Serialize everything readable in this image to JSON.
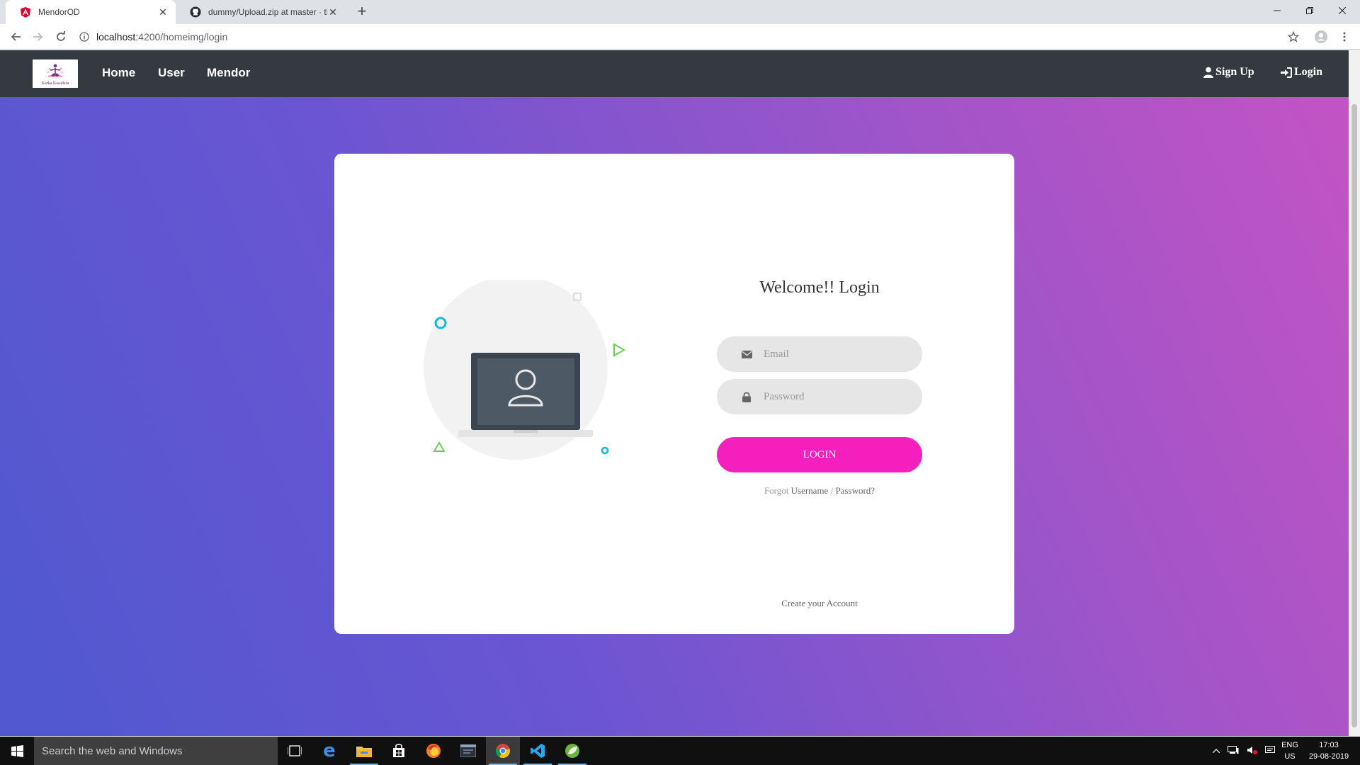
{
  "browser": {
    "tabs": [
      {
        "title": "MendorOD",
        "active": true
      },
      {
        "title": "dummy/Upload.zip at master · th",
        "active": false
      }
    ],
    "url_host": "localhost:",
    "url_path": "4200/homeimg/login"
  },
  "navbar": {
    "brand_text": "Karka Kasadara",
    "links": [
      "Home",
      "User",
      "Mendor"
    ],
    "signup": "Sign Up",
    "login": "Login"
  },
  "login_form": {
    "title": "Welcome!! Login",
    "email_placeholder": "Email",
    "password_placeholder": "Password",
    "button": "LOGIN",
    "forgot_prefix": "Forgot",
    "forgot_username": "Username",
    "forgot_sep": "/",
    "forgot_password": "Password?",
    "create_account": "Create your Account"
  },
  "taskbar": {
    "search_placeholder": "Search the web and Windows",
    "lang_line1": "ENG",
    "lang_line2": "US",
    "time": "17:03",
    "date": "29-08-2019"
  },
  "colors": {
    "gradient_start": "#4f59d0",
    "gradient_end": "#c553c4",
    "navbar": "#343a40",
    "login_button": "#f51fbe"
  }
}
